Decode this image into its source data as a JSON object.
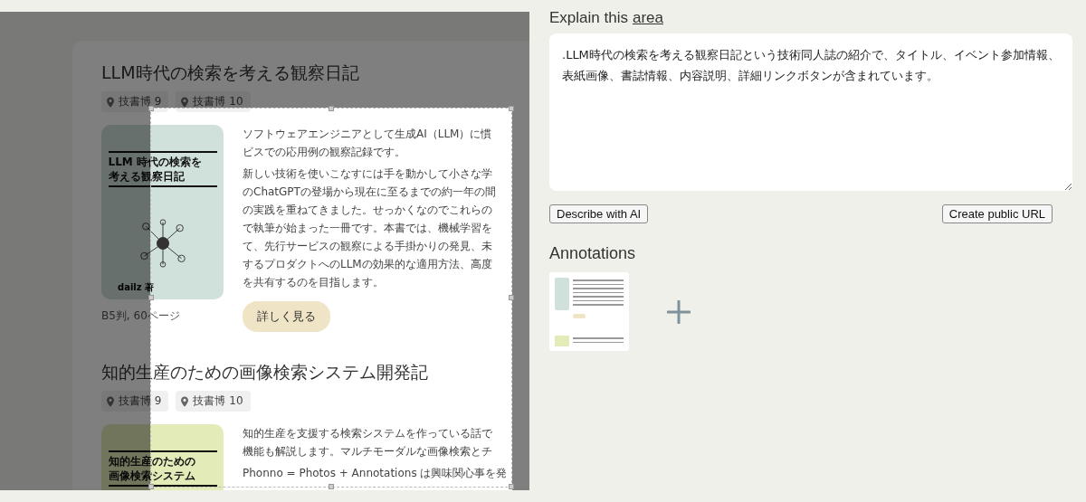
{
  "screenshot": {
    "books": [
      {
        "title": "LLM時代の検索を考える観察日記",
        "tags": [
          "技書博 9",
          "技書博 10"
        ],
        "color": "#d0e0da",
        "cover_title": [
          "LLM 時代の検索を",
          "考える観察日記"
        ],
        "cover_author": "dailz 著",
        "spec": "B5判, 60ページ",
        "paragraphs": [
          [
            "ソフトウェアエンジニアとして生成AI（LLM）に慣",
            "ビスでの応用例の観察記録です。"
          ],
          [
            "新しい技術を使いこなすには手を動かして小さな学",
            "のChatGPTの登場から現在に至るまでの約一年の間",
            "の実践を重ねてきました。せっかくなのでこれらの",
            "で執筆が始まった一冊です。本書では、機械学習を",
            "て、先行サービスの観察による手掛かりの発見、未",
            "するプロダクトへのLLMの効果的な適用方法、高度",
            "を共有するのを目指します。"
          ]
        ],
        "button": "詳しく見る"
      },
      {
        "title": "知的生産のための画像検索システム開発記",
        "tags": [
          "技書博 9",
          "技書博 10"
        ],
        "color": "#e3ebb8",
        "cover_title": [
          "知的生産のための",
          "画像検索システム"
        ],
        "paragraphs": [
          [
            "知的生産を支援する検索システムを作っている話で",
            "機能も解説します。マルチモーダルな画像検索とチ"
          ],
          [
            "Phonno = Photos + Annotations は興味関心事を発"
          ]
        ]
      }
    ]
  },
  "explain": {
    "label": "Explain this",
    "link": "area",
    "value": ".LLM時代の検索を考える観察日記という技術同人誌の紹介で、タイトル、イベント参加情報、表紙画像、書誌情報、内容説明、詳細リンクボタンが含まれています。"
  },
  "buttons": {
    "describe": "Describe with AI",
    "public_url": "Create public URL"
  },
  "annotations": {
    "title": "Annotations"
  }
}
